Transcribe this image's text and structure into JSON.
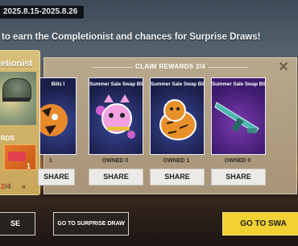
{
  "event": {
    "date_range": "2025.8.15-2025.8.26",
    "headline": "to earn the Completionist and chances for Surprise Draws!"
  },
  "left_card": {
    "title": "etionist",
    "rewards_label": "RDS",
    "item_count": "1",
    "progress_current": "2",
    "progress_total": "/4",
    "chevron": "«"
  },
  "panel": {
    "header": "CLAIM REWARDS  2/4",
    "close_icon": "close-icon",
    "cards": [
      {
        "title": "Blitz I",
        "owned": "1",
        "share": "SHARE"
      },
      {
        "title": "Summer Sale Swap Blitz II",
        "owned": "OWNED 0",
        "share": "SHARE"
      },
      {
        "title": "Summer Sale Swap Blitz III",
        "owned": "OWNED 1",
        "share": "SHARE"
      },
      {
        "title": "Summer Sale Swap Blitz I",
        "owned": "OWNED 0",
        "share": "SHARE"
      }
    ]
  },
  "buttons": {
    "left": "SE",
    "surprise_draw": "GO TO SURPRISE DRAW",
    "swap": "GO TO SWA"
  },
  "colors": {
    "accent_yellow": "#f2d233",
    "progress_red": "#d23a2a",
    "card_bg": "#1a1e48"
  }
}
